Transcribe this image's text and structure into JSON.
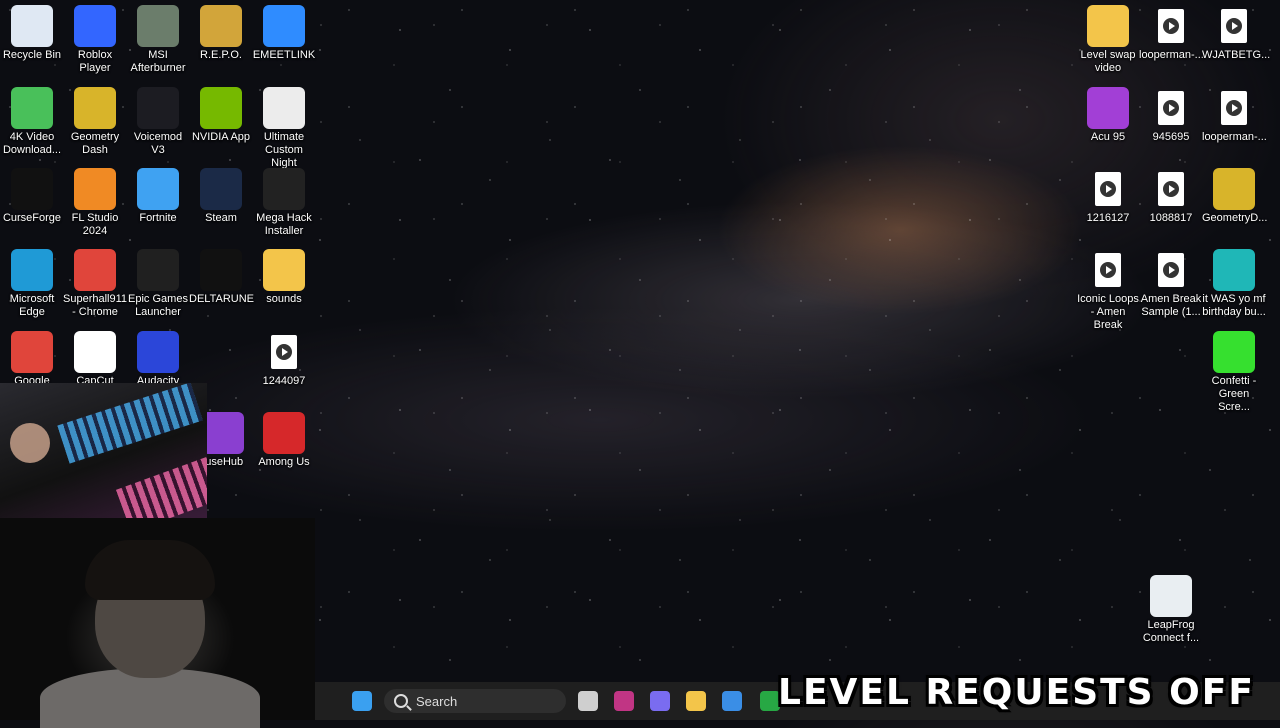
{
  "desktop": {
    "left_icons": [
      {
        "label": "Recycle Bin",
        "icon": "recycle-bin-icon",
        "color": "#dfe8f3"
      },
      {
        "label": "Roblox Player",
        "icon": "roblox-icon",
        "color": "#3366ff"
      },
      {
        "label": "MSI Afterburner",
        "icon": "msi-afterburner-icon",
        "color": "#6b7d6b"
      },
      {
        "label": "R.E.P.O.",
        "icon": "repo-icon",
        "color": "#d2a53a"
      },
      {
        "label": "EMEETLINK",
        "icon": "emeetlink-icon",
        "color": "#2f8cff"
      },
      {
        "label": "4K Video Download...",
        "icon": "4k-video-downloader-icon",
        "color": "#49c05a"
      },
      {
        "label": "Geometry Dash",
        "icon": "geometry-dash-icon",
        "color": "#d8b42a"
      },
      {
        "label": "Voicemod V3",
        "icon": "voicemod-icon",
        "color": "#1c1c22"
      },
      {
        "label": "NVIDIA App",
        "icon": "nvidia-icon",
        "color": "#76b900"
      },
      {
        "label": "Ultimate Custom Night",
        "icon": "ultimate-custom-night-icon",
        "color": "#ececec"
      },
      {
        "label": "CurseForge",
        "icon": "curseforge-icon",
        "color": "#111111"
      },
      {
        "label": "FL Studio 2024",
        "icon": "fl-studio-icon",
        "color": "#f08a24"
      },
      {
        "label": "Fortnite",
        "icon": "fortnite-icon",
        "color": "#3fa2f2"
      },
      {
        "label": "Steam",
        "icon": "steam-icon",
        "color": "#1b2a47"
      },
      {
        "label": "Mega Hack Installer",
        "icon": "mega-hack-icon",
        "color": "#222222"
      },
      {
        "label": "Microsoft Edge",
        "icon": "edge-icon",
        "color": "#1f9ad6"
      },
      {
        "label": "Superhall911 - Chrome",
        "icon": "chrome-icon",
        "color": "#e0453b"
      },
      {
        "label": "Epic Games Launcher",
        "icon": "epic-games-icon",
        "color": "#202020"
      },
      {
        "label": "DELTARUNE",
        "icon": "deltarune-icon",
        "color": "#111111"
      },
      {
        "label": "sounds",
        "icon": "folder-icon",
        "color": "#f3c54a"
      },
      {
        "label": "Google",
        "icon": "google-chrome-icon",
        "color": "#e0453b"
      },
      {
        "label": "CapCut",
        "icon": "capcut-icon",
        "color": "#ffffff"
      },
      {
        "label": "Audacity",
        "icon": "audacity-icon",
        "color": "#2b46d9"
      },
      {
        "label": "1244097",
        "icon": "media-file-icon",
        "color": "#ffffff"
      },
      {
        "label": "luseHub",
        "icon": "musehub-icon",
        "color": "#8a3fd0"
      },
      {
        "label": "Among Us",
        "icon": "among-us-icon",
        "color": "#d6282a"
      }
    ],
    "right_icons": [
      {
        "label": "Level swap video",
        "icon": "folder-icon",
        "color": "#f3c54a"
      },
      {
        "label": "looperman-...",
        "icon": "media-file-icon",
        "color": "#ffffff"
      },
      {
        "label": "WJATBETG...",
        "icon": "media-file-icon",
        "color": "#ffffff"
      },
      {
        "label": "Acu 95",
        "icon": "acu-icon",
        "color": "#a23fd6"
      },
      {
        "label": "945695",
        "icon": "media-file-icon",
        "color": "#ffffff"
      },
      {
        "label": "looperman-...",
        "icon": "media-file-icon",
        "color": "#ffffff"
      },
      {
        "label": "1216127",
        "icon": "media-file-icon",
        "color": "#ffffff"
      },
      {
        "label": "1088817",
        "icon": "media-file-icon",
        "color": "#ffffff"
      },
      {
        "label": "GeometryD...",
        "icon": "geometry-dash-icon",
        "color": "#d8b42a"
      },
      {
        "label": "Iconic Loops - Amen Break",
        "icon": "media-file-icon",
        "color": "#ffffff"
      },
      {
        "label": "Amen Break Sample (1...",
        "icon": "media-file-icon",
        "color": "#ffffff"
      },
      {
        "label": "it WAS yo mf birthday bu...",
        "icon": "video-file-icon",
        "color": "#1fb7b7"
      },
      {
        "label": "Confetti - Green Scre...",
        "icon": "video-file-icon",
        "color": "#36e02f"
      },
      {
        "label": "LeapFrog Connect f...",
        "icon": "leapfrog-icon",
        "color": "#e9eef2"
      }
    ]
  },
  "taskbar": {
    "search_placeholder": "Search",
    "apps": [
      {
        "icon": "windows-start-icon",
        "color": "#3aa0f0"
      },
      {
        "icon": "task-view-icon",
        "color": "#cfcfcf"
      },
      {
        "icon": "instagram-icon",
        "color": "#c13584"
      },
      {
        "icon": "copilot-icon",
        "color": "#7a6cf0"
      },
      {
        "icon": "file-explorer-icon",
        "color": "#f3c54a"
      },
      {
        "icon": "microsoft-store-icon",
        "color": "#3a8ee6"
      },
      {
        "icon": "xbox-icon",
        "color": "#27a844"
      }
    ]
  },
  "overlay": {
    "text": "LEVEL REQUESTS OFF"
  }
}
